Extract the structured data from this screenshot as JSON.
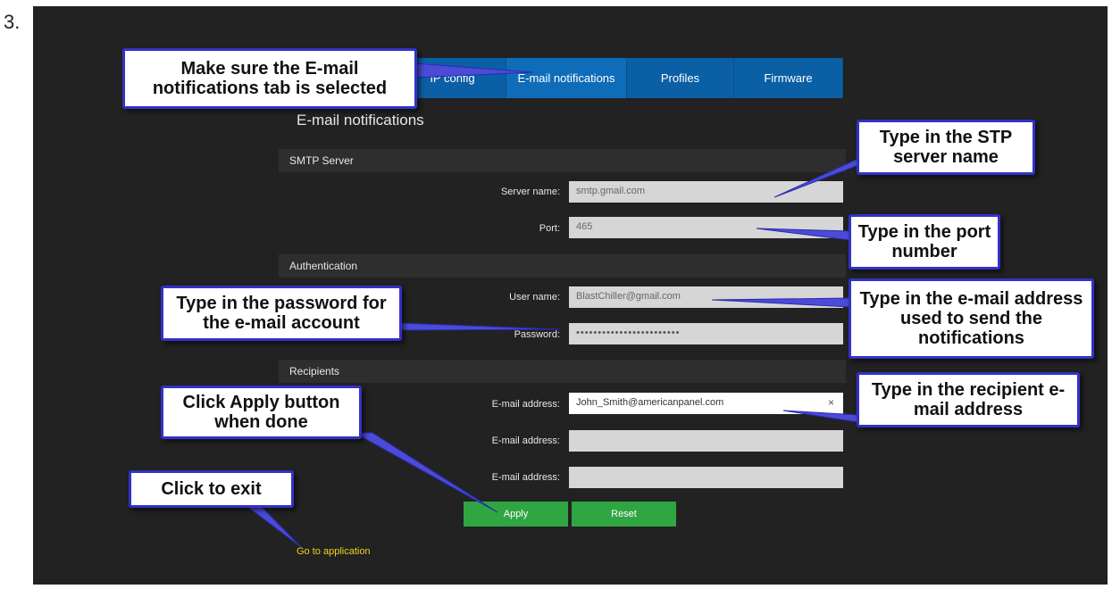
{
  "step_number": "3.",
  "tabs": [
    {
      "label": "IP config"
    },
    {
      "label": "E-mail notifications"
    },
    {
      "label": "Profiles"
    },
    {
      "label": "Firmware"
    }
  ],
  "page_title": "E-mail notifications",
  "smtp": {
    "section_label": "SMTP Server",
    "server_label": "Server name:",
    "server_value": "smtp.gmail.com",
    "port_label": "Port:",
    "port_value": "465"
  },
  "auth": {
    "section_label": "Authentication",
    "user_label": "User name:",
    "user_value": "BlastChiller@gmail.com",
    "password_label": "Password:",
    "password_value": "••••••••••••••••••••••••"
  },
  "recipients": {
    "section_label": "Recipients",
    "email_label": "E-mail address:",
    "email1_value": "John_Smith@americanpanel.com",
    "email2_value": "",
    "email3_value": "",
    "clear_symbol": "×"
  },
  "buttons": {
    "apply": "Apply",
    "reset": "Reset"
  },
  "goto_app": "Go to application",
  "callouts": {
    "tab": "Make sure the E-mail notifications tab is selected",
    "server": "Type in the STP server name",
    "port": "Type in the port number",
    "password": "Type in the password for the e-mail account",
    "username": "Type in the e-mail address used to send the notifications",
    "recipient": "Type in the recipient e-mail address",
    "apply": "Click Apply button when done",
    "exit": "Click to exit"
  },
  "colors": {
    "background": "#222222",
    "tab_blue": "#0b5fa5",
    "button_green": "#2fa642",
    "link_yellow": "#f0d21a",
    "callout_border": "#3232c8"
  }
}
